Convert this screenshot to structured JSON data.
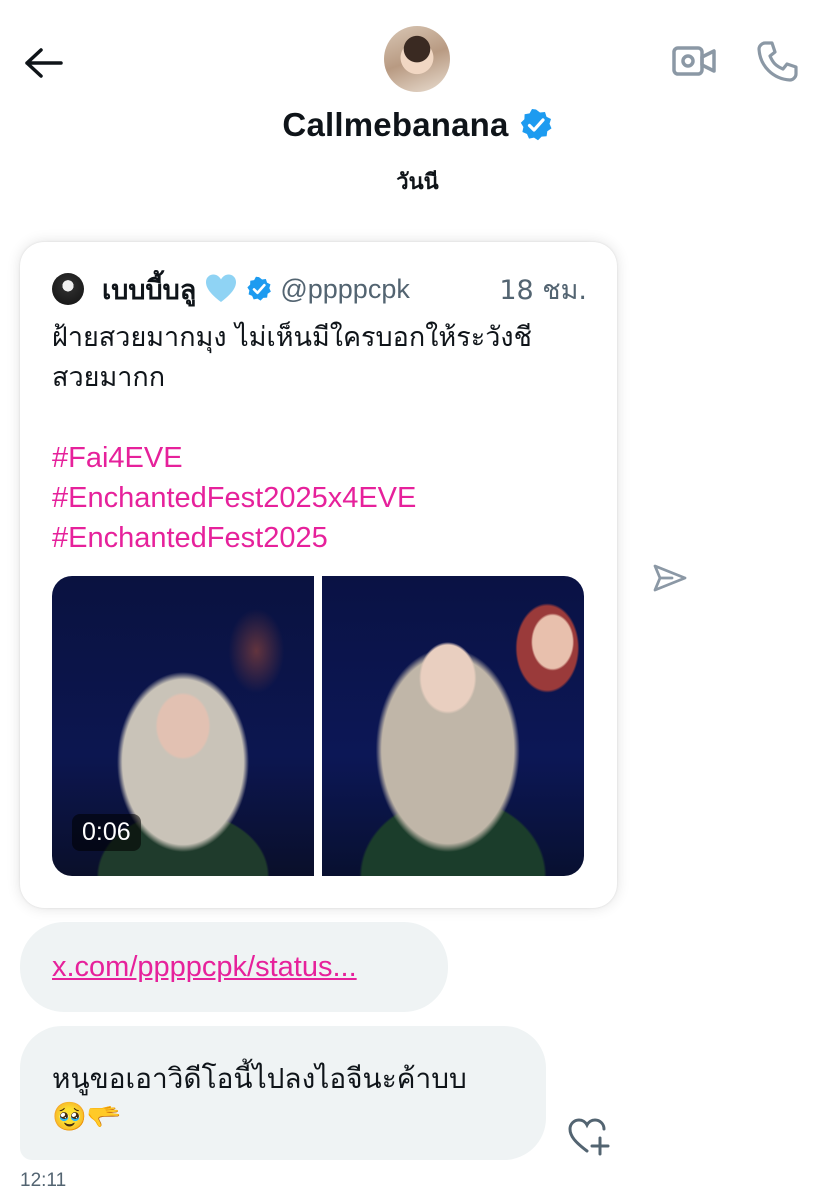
{
  "header": {
    "name": "Callmebanana",
    "verified": true,
    "date_separator": "วันนี",
    "icons": {
      "back": "arrow-left-icon",
      "video": "video-camera-icon",
      "phone": "phone-icon",
      "verified": "verified-badge-icon"
    }
  },
  "tweet": {
    "author": "เบบบี้บลู",
    "author_emoji": "light-blue-heart-icon",
    "handle": "@ppppcpk",
    "time": "18 ชม.",
    "text_lines": [
      "ฝ้ายสวยมากมุง ไม่เห็นมีใครบอกให้ระวังชี",
      "สวยมากก"
    ],
    "hashtags": [
      "#Fai4EVE",
      "#EnchantedFest2025x4EVE",
      "#EnchantedFest2025"
    ],
    "media": [
      {
        "type": "video",
        "duration": "0:06"
      },
      {
        "type": "photo"
      }
    ]
  },
  "link_message": {
    "text": "x.com/ppppcpk/status..."
  },
  "message": {
    "text": "หนูขอเอาวิดีโอนี้ไปลงไอจีนะค้าบบ",
    "emojis": "🥹🫳",
    "time": "12:11"
  },
  "colors": {
    "accent": "#e6219b",
    "verified": "#1d9bf0",
    "bubble": "#eff3f4",
    "muted": "#536471",
    "icon_gray": "#8b98a5"
  }
}
